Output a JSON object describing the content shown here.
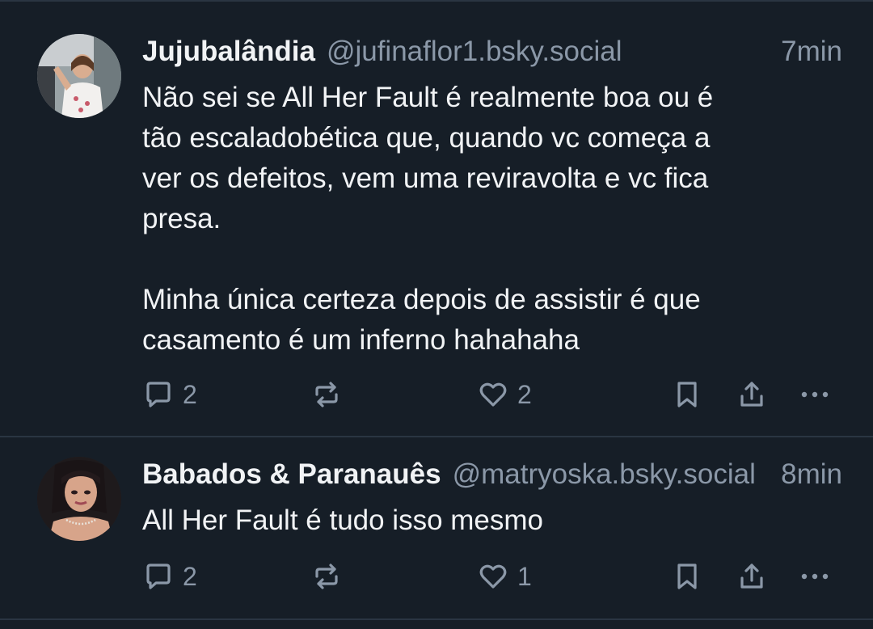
{
  "colors": {
    "background": "#161e27",
    "divider": "#2a3542",
    "text_primary": "#f1f3f5",
    "text_secondary": "#8b98a8"
  },
  "posts": [
    {
      "author_name": "Jujubalândia",
      "handle": "@jufinaflor1.bsky.social",
      "time": "7min",
      "avatar": "avatar-photo-woman-street",
      "text": "Não sei se All Her Fault é realmente boa ou é\ntão escaladobética que, quando vc começa a\nver os defeitos, vem uma reviravolta e vc fica\npresa.\n\nMinha única certeza depois de assistir é que\ncasamento é um inferno hahahaha",
      "reply_count": "2",
      "like_count": "2",
      "icons": [
        "reply-icon",
        "repost-icon",
        "like-icon",
        "bookmark-icon",
        "share-icon",
        "more-icon"
      ]
    },
    {
      "author_name": "Babados & Paranauês",
      "handle": "@matryoska.bsky.social",
      "time": "8min",
      "avatar": "avatar-photo-portrait",
      "text": "All Her Fault é tudo isso mesmo",
      "reply_count": "2",
      "like_count": "1",
      "icons": [
        "reply-icon",
        "repost-icon",
        "like-icon",
        "bookmark-icon",
        "share-icon",
        "more-icon"
      ]
    }
  ]
}
